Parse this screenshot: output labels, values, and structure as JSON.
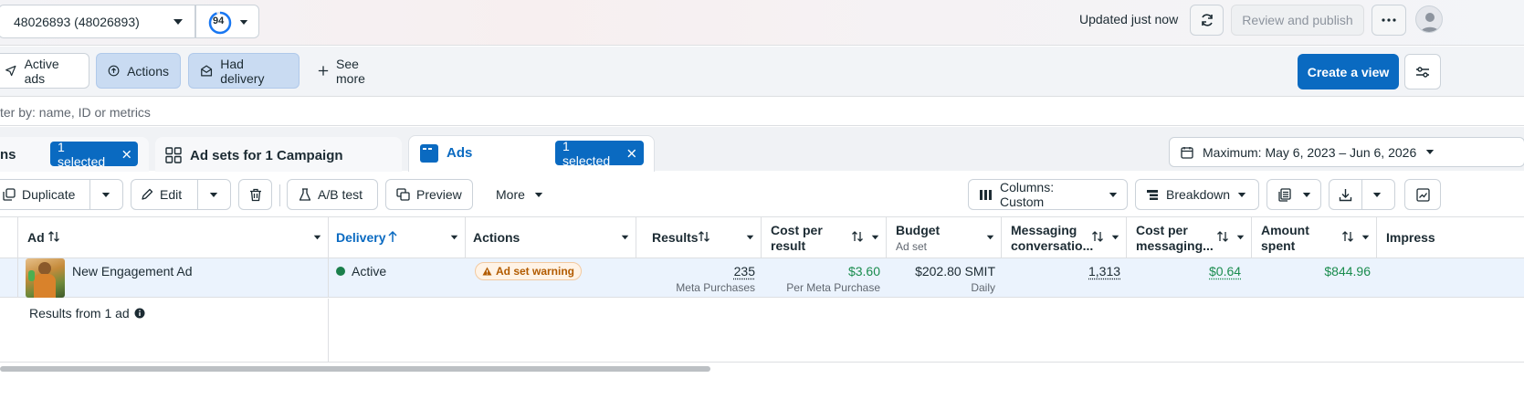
{
  "topbar": {
    "account": "48026893 (48026893)",
    "score": "94",
    "updated": "Updated just now",
    "publish_label": "Review and publish"
  },
  "filters": {
    "chips": [
      "Active ads",
      "Actions",
      "Had delivery"
    ],
    "see_more": "See more",
    "create_view": "Create a view"
  },
  "search": {
    "placeholder": "ter by: name, ID or metrics"
  },
  "tabs": {
    "campaigns_fragment": "ns",
    "campaigns_selected": "1 selected",
    "adsets_label": "Ad sets for 1 Campaign",
    "ads_label": "Ads",
    "ads_selected": "1 selected",
    "date_range": "Maximum: May 6, 2023 – Jun 6, 2026"
  },
  "toolbar": {
    "duplicate": "Duplicate",
    "edit": "Edit",
    "ab_test": "A/B test",
    "preview": "Preview",
    "more": "More",
    "columns": "Columns: Custom",
    "breakdown": "Breakdown"
  },
  "table": {
    "headers": {
      "ad": "Ad",
      "delivery": "Delivery",
      "actions": "Actions",
      "results": "Results",
      "cost_per_result_1": "Cost per",
      "cost_per_result_2": "result",
      "budget": "Budget",
      "budget_sub": "Ad set",
      "messaging_1": "Messaging",
      "messaging_2": "conversatio...",
      "cost_messaging_1": "Cost per",
      "cost_messaging_2": "messaging...",
      "amount_1": "Amount",
      "amount_2": "spent",
      "impressions": "Impress"
    },
    "row": {
      "ad_name": "New Engagement Ad",
      "delivery": "Active",
      "actions_badge": "Ad set warning",
      "results": "235",
      "results_sub": "Meta Purchases",
      "cost_per_result": "$3.60",
      "cost_per_result_sub": "Per Meta Purchase",
      "budget": "$202.80 SMIT",
      "budget_sub": "Daily",
      "messaging": "1,313",
      "cost_per_messaging": "$0.64",
      "amount_spent": "$844.96"
    },
    "summary": "Results from 1 ad"
  },
  "colors": {
    "primary": "#0a6ac1",
    "selected_chip": "#c9dbf2",
    "active_dot": "#1a7f4b",
    "warning": "#b25b00",
    "positive": "#1a8c4e"
  }
}
